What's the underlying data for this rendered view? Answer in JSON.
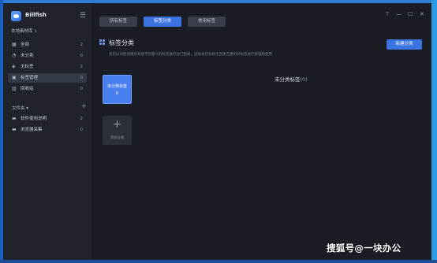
{
  "app": {
    "name": "Billfish",
    "menu_icon": "hamburger-icon"
  },
  "library": {
    "label": "本地素材库",
    "arrow": "⇕"
  },
  "sidebar": {
    "items": [
      {
        "label": "全部",
        "count": "2",
        "icon": "grid-icon"
      },
      {
        "label": "未分类",
        "count": "0",
        "icon": "clock-icon"
      },
      {
        "label": "无标签",
        "count": "2",
        "icon": "tag-icon"
      },
      {
        "label": "标签管理",
        "count": "0",
        "icon": "tag-manage-icon"
      },
      {
        "label": "回收站",
        "count": "0",
        "icon": "trash-icon"
      }
    ],
    "folders_title": "文件夹",
    "folders_add": "+",
    "folders": [
      {
        "label": "软件使用说明",
        "count": "2",
        "icon": "folder-icon"
      },
      {
        "label": "浏览器采集",
        "count": "0",
        "icon": "folder-icon"
      }
    ]
  },
  "tabs": [
    {
      "label": "所有标签"
    },
    {
      "label": "标签分类"
    },
    {
      "label": "常用标签"
    }
  ],
  "window_controls": {
    "pin": "⊤",
    "minimize": "—",
    "maximize": "☐",
    "close": "✕"
  },
  "main": {
    "title": "标签分类",
    "description": "您可以对您创建的有意不同意义的标签进行分门别类，这样也许有助于您更方便的对标签进行管理和使用",
    "new_button": "新建分类",
    "category_card": {
      "name": "未分类标签",
      "count": "0"
    },
    "uncategorized_title": "未分类标签",
    "uncategorized_count": "(0)",
    "add_card_label": "添加分类",
    "add_card_plus": "+"
  },
  "watermark": "搜狐号@一块办公",
  "colors": {
    "accent": "#3b74e0",
    "sidebar_bg": "#20232b",
    "main_bg": "#1b1d24"
  }
}
